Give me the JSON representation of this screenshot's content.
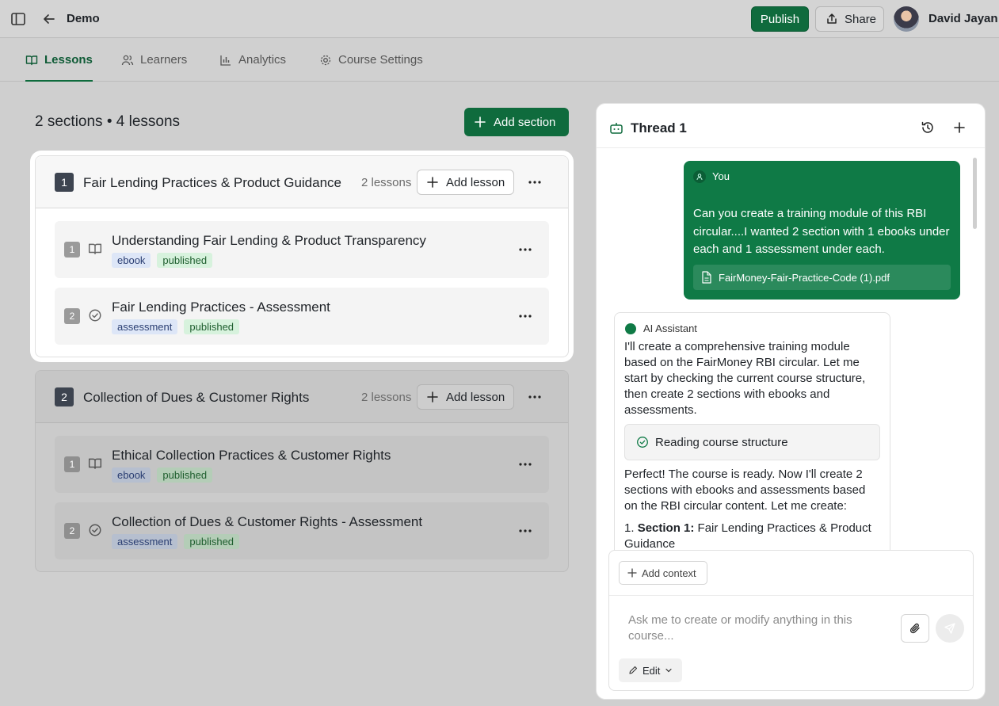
{
  "header": {
    "title": "Demo",
    "publish_label": "Publish",
    "share_label": "Share",
    "user_name": "David Jayan"
  },
  "tabs": [
    {
      "label": "Lessons",
      "icon": "book-icon",
      "active": true
    },
    {
      "label": "Learners",
      "icon": "users-icon",
      "active": false
    },
    {
      "label": "Analytics",
      "icon": "bar-chart-icon",
      "active": false
    },
    {
      "label": "Course Settings",
      "icon": "gear-icon",
      "active": false
    }
  ],
  "main": {
    "summary": "2 sections • 4 lessons",
    "add_section_label": "Add section",
    "sections": [
      {
        "number": "1",
        "title": "Fair Lending Practices & Product Guidance",
        "count": "2 lessons",
        "add_lesson_label": "Add lesson",
        "lessons": [
          {
            "number": "1",
            "icon": "book-icon",
            "title": "Understanding Fair Lending & Product Transparency",
            "type": "ebook",
            "status": "published"
          },
          {
            "number": "2",
            "icon": "check-circle-icon",
            "title": "Fair Lending Practices - Assessment",
            "type": "assessment",
            "status": "published"
          }
        ]
      },
      {
        "number": "2",
        "title": "Collection of Dues & Customer Rights",
        "count": "2 lessons",
        "add_lesson_label": "Add lesson",
        "lessons": [
          {
            "number": "1",
            "icon": "book-icon",
            "title": "Ethical Collection Practices & Customer Rights",
            "type": "ebook",
            "status": "published"
          },
          {
            "number": "2",
            "icon": "check-circle-icon",
            "title": "Collection of Dues & Customer Rights - Assessment",
            "type": "assessment",
            "status": "published"
          }
        ]
      }
    ]
  },
  "thread": {
    "title": "Thread 1",
    "user_message": {
      "author": "You",
      "text": "Can you create a training module of this RBI circular....I wanted 2 section with 1 ebooks under each and 1 assessment under each.",
      "attachment": "FairMoney-Fair-Practice-Code (1).pdf"
    },
    "ai_message": {
      "author": "AI Assistant",
      "text": "I'll create a comprehensive training module based on the FairMoney RBI circular. Let me start by checking the current course structure, then create 2 sections with ebooks and assessments.",
      "tool_chip": "Reading course structure",
      "text2": "Perfect! The course is ready. Now I'll create 2 sections with ebooks and assessments based on the RBI circular content. Let me create:",
      "list": [
        {
          "label": "Section 1:",
          "value": "Fair Lending Practices & Product Guidance"
        }
      ]
    },
    "composer": {
      "add_context_label": "Add context",
      "placeholder": "Ask me to create or modify anything in this course...",
      "mode_label": "Edit"
    }
  },
  "colors": {
    "brand_green": "#0f6b3d",
    "user_bubble": "#0f7a46"
  }
}
